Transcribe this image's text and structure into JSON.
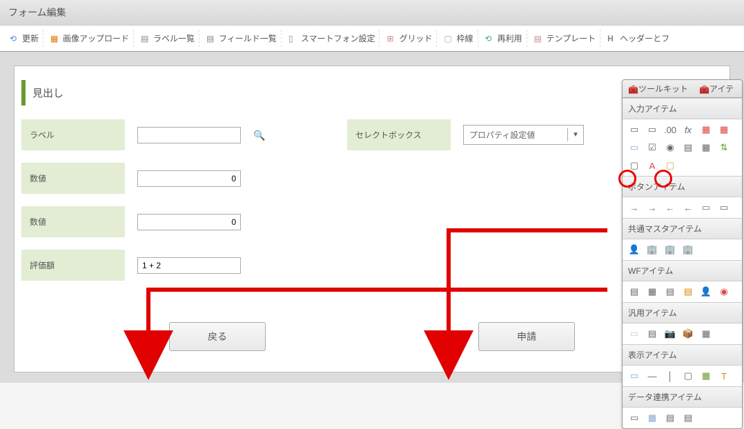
{
  "title": "フォーム編集",
  "toolbar": [
    {
      "label": "更新",
      "icon": "refresh"
    },
    {
      "label": "画像アップロード",
      "icon": "image"
    },
    {
      "label": "ラベル一覧",
      "icon": "list"
    },
    {
      "label": "フィールド一覧",
      "icon": "list"
    },
    {
      "label": "スマートフォン設定",
      "icon": "phone"
    },
    {
      "label": "グリッド",
      "icon": "grid"
    },
    {
      "label": "枠線",
      "icon": "border"
    },
    {
      "label": "再利用",
      "icon": "reuse"
    },
    {
      "label": "テンプレート",
      "icon": "template"
    },
    {
      "label": "ヘッダーとフ",
      "icon": "header"
    }
  ],
  "heading": "見出し",
  "fields": {
    "label": {
      "lbl": "ラベル",
      "val": ""
    },
    "select": {
      "lbl": "セレクトボックス",
      "val": "プロパティ設定値"
    },
    "num1": {
      "lbl": "数値",
      "val": "0"
    },
    "num2": {
      "lbl": "数値",
      "val": "0"
    },
    "eval": {
      "lbl": "評価額",
      "val": "1 + 2"
    }
  },
  "buttons": {
    "back": "戻る",
    "apply": "申請"
  },
  "palette": {
    "tabs": [
      "ツールキット",
      "アイテ"
    ],
    "sections": [
      "入力アイテム",
      "ボタンアイテム",
      "共通マスタアイテム",
      "WFアイテム",
      "汎用アイテム",
      "表示アイテム",
      "データ連携アイテム"
    ]
  }
}
